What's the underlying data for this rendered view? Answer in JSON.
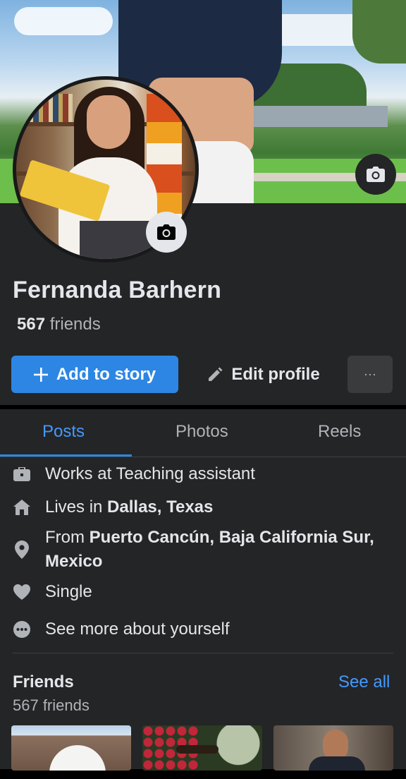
{
  "profile": {
    "name": "Fernanda Barhern",
    "friends_count": "567",
    "friends_word": "friends"
  },
  "actions": {
    "add_story_label": "Add to story",
    "edit_profile_label": "Edit profile",
    "more_label": "···"
  },
  "tabs": [
    {
      "label": "Posts",
      "active": true
    },
    {
      "label": "Photos",
      "active": false
    },
    {
      "label": "Reels",
      "active": false
    }
  ],
  "details": {
    "work": "Works at Teaching assistant",
    "lives_prefix": "Lives in ",
    "lives_place": "Dallas, Texas",
    "from_prefix": "From ",
    "from_place_line1": "Puerto Cancún, Baja California Sur,",
    "from_place_line2": "Mexico",
    "relationship": "Single",
    "see_more": "See more about yourself"
  },
  "friends_section": {
    "title": "Friends",
    "see_all": "See all",
    "subtitle": "567 friends"
  },
  "colors": {
    "accent": "#2d86e4",
    "link": "#4599ff",
    "panel": "#242526"
  }
}
